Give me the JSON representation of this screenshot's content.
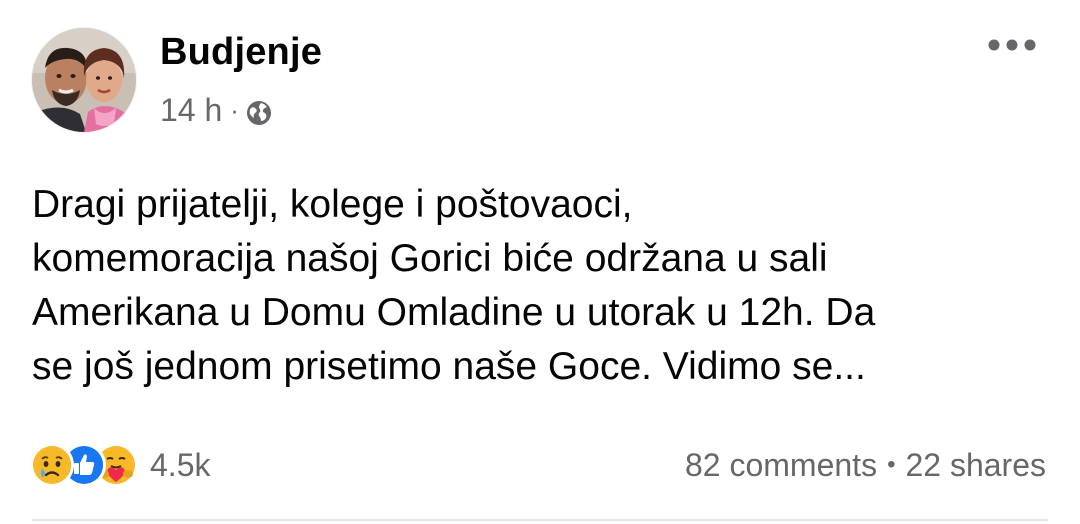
{
  "post": {
    "author": "Budjenje",
    "timestamp": "14 h",
    "meta_separator": "·",
    "privacy_icon": "globe-icon",
    "more_icon": "more-horizontal-icon",
    "text": "Dragi prijatelji, kolege i poštovaoci,\nkomemoracija našoj Gorici biće održana u sali\nAmerikana u Domu Omladine u utorak u 12h. Da\nse još jednom prisetimo naše Goce. Vidimo se...",
    "reactions": {
      "icons": [
        "sad-reaction-icon",
        "like-reaction-icon",
        "care-reaction-icon"
      ],
      "count": "4.5k"
    },
    "comments": "82 comments",
    "stat_separator": "•",
    "shares": "22 shares"
  },
  "colors": {
    "text_primary": "#050505",
    "text_secondary": "#65676b",
    "like_blue": "#1877f2",
    "reaction_yellow": "#f7b928",
    "care_red": "#f02849",
    "divider": "#e4e6eb"
  }
}
